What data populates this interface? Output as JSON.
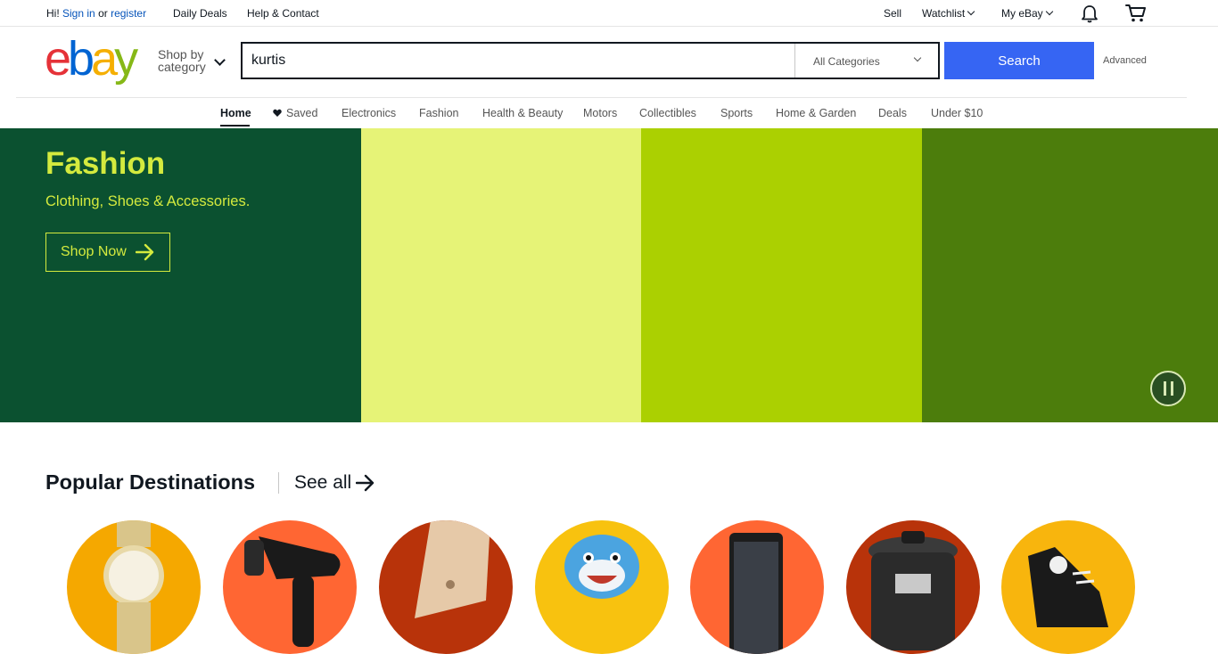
{
  "topbar": {
    "hi": "Hi!",
    "sign_in": "Sign in",
    "or": "or",
    "register": "register",
    "daily_deals": "Daily Deals",
    "help": "Help & Contact",
    "sell": "Sell",
    "watchlist": "Watchlist",
    "my_ebay": "My eBay",
    "icons": [
      "bell-icon",
      "cart-icon"
    ]
  },
  "header": {
    "logo": {
      "letters": [
        "e",
        "b",
        "a",
        "y"
      ],
      "colors": [
        "#e53238",
        "#0064d2",
        "#f5af02",
        "#86b817"
      ]
    },
    "shop_by_line1": "Shop by",
    "shop_by_line2": "category",
    "search": {
      "value": "kurtis",
      "category": "All Categories",
      "button": "Search"
    },
    "advanced": "Advanced"
  },
  "nav": {
    "items": [
      "Home",
      "Saved",
      "Electronics",
      "Fashion",
      "Health & Beauty",
      "Motors",
      "Collectibles",
      "Sports",
      "Home & Garden",
      "Deals",
      "Under $10"
    ],
    "active": "Home"
  },
  "hero": {
    "title": "Fashion",
    "subtitle": "Clothing, Shoes & Accessories.",
    "cta": "Shop Now",
    "panel_colors": [
      "#0b5130",
      "#e6f377",
      "#abd001",
      "#4c7d0c"
    ],
    "text_color": "#d4ea3e"
  },
  "popular": {
    "title": "Popular Destinations",
    "see_all": "See all",
    "items": [
      {
        "icon": "watch-icon",
        "bg": "#f5a800"
      },
      {
        "icon": "hair-dryer-icon",
        "bg": "#ff6633"
      },
      {
        "icon": "laptop-icon",
        "bg": "#b8330a"
      },
      {
        "icon": "toy-shark-icon",
        "bg": "#f8c20f"
      },
      {
        "icon": "phone-icon",
        "bg": "#ff6633"
      },
      {
        "icon": "pressure-cooker-icon",
        "bg": "#b8330a"
      },
      {
        "icon": "sneaker-icon",
        "bg": "#f8b50d"
      }
    ]
  },
  "colors": {
    "accent": "#3665f3",
    "link": "#0654ba"
  }
}
